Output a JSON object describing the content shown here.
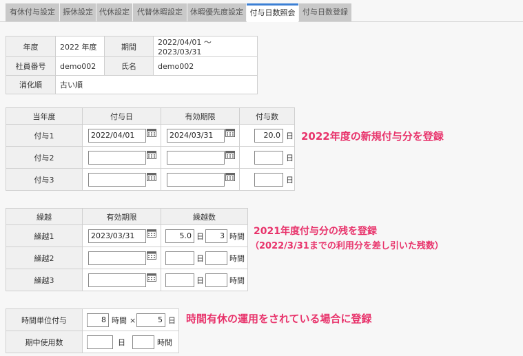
{
  "tabs": [
    {
      "label": "有休付与設定"
    },
    {
      "label": "振休設定"
    },
    {
      "label": "代休設定"
    },
    {
      "label": "代替休暇設定"
    },
    {
      "label": "休暇優先度設定"
    },
    {
      "label": "付与日数照会",
      "active": true
    },
    {
      "label": "付与日数登録"
    }
  ],
  "info": {
    "year_label": "年度",
    "year_value": "2022 年度",
    "period_label": "期間",
    "period_value": "2022/04/01 ～ 2023/03/31",
    "emp_no_label": "社員番号",
    "emp_no_value": "demo002",
    "name_label": "氏名",
    "name_value": "demo002",
    "order_label": "消化順",
    "order_value": "古い順"
  },
  "grant": {
    "headers": [
      "当年度",
      "付与日",
      "有効期限",
      "付与数"
    ],
    "rows": [
      {
        "label": "付与1",
        "grant_date": "2022/04/01",
        "expiry": "2024/03/31",
        "count": "20.0"
      },
      {
        "label": "付与2",
        "grant_date": "",
        "expiry": "",
        "count": ""
      },
      {
        "label": "付与3",
        "grant_date": "",
        "expiry": "",
        "count": ""
      }
    ],
    "unit_day": "日"
  },
  "carry": {
    "headers": [
      "繰越",
      "有効期限",
      "繰越数"
    ],
    "rows": [
      {
        "label": "繰越1",
        "expiry": "2023/03/31",
        "days": "5.0",
        "hours": "3"
      },
      {
        "label": "繰越2",
        "expiry": "",
        "days": "",
        "hours": ""
      },
      {
        "label": "繰越3",
        "expiry": "",
        "days": "",
        "hours": ""
      }
    ],
    "unit_day": "日",
    "unit_hour": "時間"
  },
  "hourly": {
    "grant_label": "時間単位付与",
    "hours_per_day": "8",
    "unit_hours": "時間",
    "times_sign": "×",
    "days": "5",
    "unit_day": "日",
    "used_label": "期中使用数",
    "used_days": "",
    "used_unit_day": "日",
    "used_hours": "",
    "used_unit_hours": "時間"
  },
  "annotations": {
    "grant_note": "2022年度の新規付与分を登録",
    "carry_note_1": "2021年度付与分の残を登録",
    "carry_note_2": "（2022/3/31までの利用分を差し引いた残数）",
    "hourly_note": "時間有休の運用をされている場合に登録"
  },
  "colors": {
    "accent": "#3b7fd4",
    "annotation": "#e8336b"
  }
}
